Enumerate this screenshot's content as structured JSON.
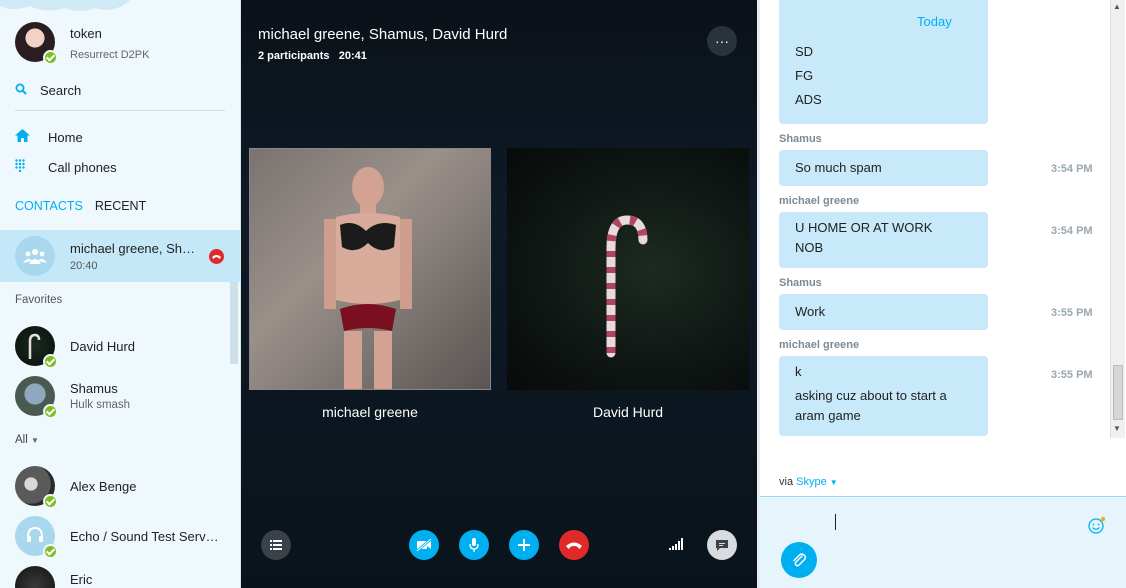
{
  "sidebar": {
    "profile": {
      "name": "token",
      "mood": "Resurrect D2PK"
    },
    "search_label": "Search",
    "nav": {
      "home": "Home",
      "call_phones": "Call phones"
    },
    "tabs": {
      "contacts": "CONTACTS",
      "recent": "RECENT"
    },
    "active_chat": {
      "name": "michael greene, Shamus, David Hurd",
      "time": "20:40"
    },
    "favorites_label": "Favorites",
    "favorites": [
      {
        "name": "David Hurd",
        "mood": ""
      },
      {
        "name": "Shamus",
        "mood": "Hulk smash"
      }
    ],
    "all_label": "All",
    "contacts": [
      {
        "name": "Alex Benge"
      },
      {
        "name": "Echo / Sound Test Service"
      },
      {
        "name": "Eric"
      }
    ]
  },
  "call": {
    "title": "michael greene, Shamus, David Hurd",
    "participants": "2 participants",
    "duration": "20:41",
    "more_label": "···",
    "tiles": [
      {
        "name": "michael greene"
      },
      {
        "name": "David Hurd"
      }
    ]
  },
  "chat": {
    "today_label": "Today",
    "first_bubble_lines": [
      "SD",
      "FG",
      "ADS"
    ],
    "messages": [
      {
        "sender": "Shamus",
        "lines": [
          "So much spam"
        ],
        "time": "3:54 PM"
      },
      {
        "sender": "michael greene",
        "lines": [
          "U HOME OR AT WORK",
          "NOB"
        ],
        "time": "3:54 PM"
      },
      {
        "sender": "Shamus",
        "lines": [
          "Work"
        ],
        "time": "3:55 PM"
      },
      {
        "sender": "michael greene",
        "lines": [
          "k",
          "asking cuz about to start a aram game"
        ],
        "time": "3:55 PM"
      }
    ],
    "via_label": "via",
    "via_service": "Skype"
  },
  "colors": {
    "accent": "#00aff0",
    "end_call": "#e02a2a",
    "online": "#7dbe22",
    "bubble": "#c7e9f9"
  }
}
